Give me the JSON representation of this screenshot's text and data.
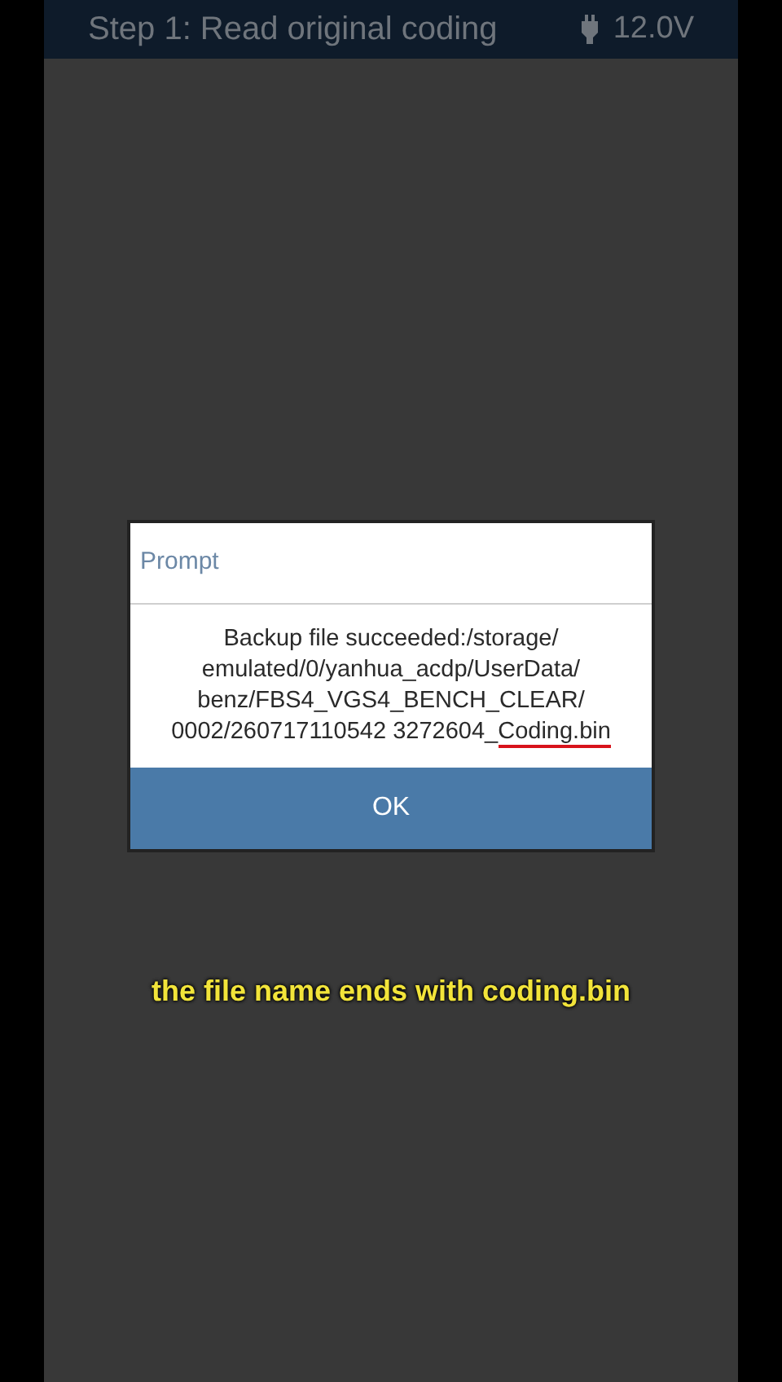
{
  "header": {
    "title": "Step 1: Read original coding",
    "voltage": "12.0V"
  },
  "dialog": {
    "title": "Prompt",
    "message": "Backup file succeeded:/storage/ emulated/0/yanhua_acdp/UserData/ benz/FBS4_VGS4_BENCH_CLEAR/ 0002/260717110542 3272604_",
    "marked": "Coding.bin",
    "button": "OK"
  },
  "caption": "the file name ends with coding.bin"
}
